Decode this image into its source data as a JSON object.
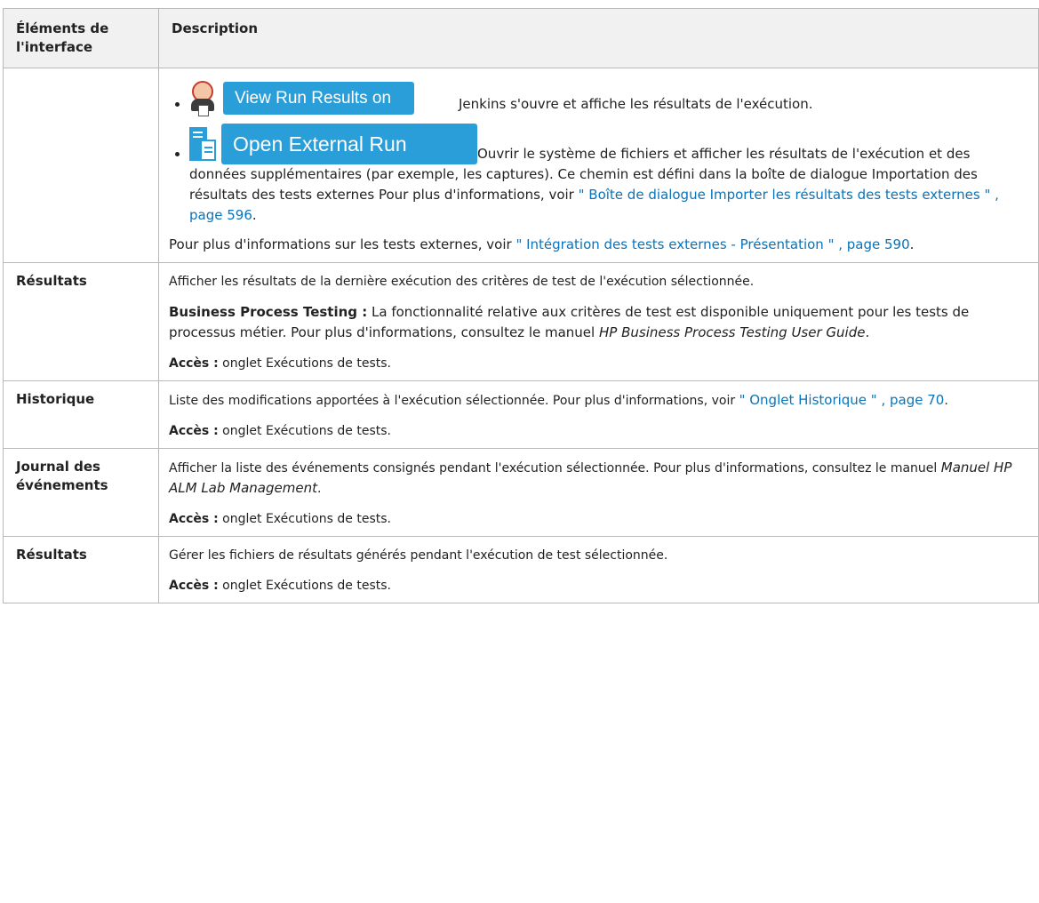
{
  "header": {
    "col1": "Éléments de l'interface",
    "col2": "Description"
  },
  "row_buttons": {
    "jenkins": {
      "button_label": "View Run Results on Jenkins",
      "icon": "jenkins-icon",
      "text": "Jenkins s'ouvre et affiche les résultats de l'exécution."
    },
    "external": {
      "button_label": "Open External Run Results Path",
      "icon": "file-document-icon",
      "text": "Ouvrir le système de fichiers et afficher les résultats de l'exécution et des données supplémentaires (par exemple, les captures). Ce chemin est défini dans la boîte de dialogue Importation des résultats des tests externes Pour plus d'informations, voir ",
      "link": "\" Boîte de dialogue Importer les résultats des tests externes \" , page 596",
      "after": "."
    },
    "footer_text": "Pour plus d'informations sur les tests externes, voir ",
    "footer_link": "\" Intégration des tests externes - Présentation \" , page 590",
    "footer_after": "."
  },
  "rows": [
    {
      "name": "Résultats",
      "desc": "Afficher les résultats de la dernière exécution des critères de test de l'exécution sélectionnée.",
      "bpt_label": "Business Process Testing :",
      "bpt_text": " La fonctionnalité relative aux critères de test est disponible uniquement pour les tests de processus métier. Pour plus d'informations, consultez le manuel ",
      "bpt_ital": "HP Business Process Testing User Guide",
      "bpt_after": ".",
      "access_label": "Accès :",
      "access_text": " onglet Exécutions de tests."
    },
    {
      "name": "Historique",
      "desc": "Liste des modifications apportées à l'exécution sélectionnée. Pour plus d'informations, voir ",
      "link": "\" Onglet Historique \" , page 70",
      "after": ".",
      "access_label": "Accès :",
      "access_text": " onglet Exécutions de tests."
    },
    {
      "name": "Journal des événements",
      "desc": "Afficher la liste des événements consignés pendant l'exécution sélectionnée. Pour plus d'informations, consultez le manuel ",
      "ital": "Manuel HP ALM Lab Management",
      "after": ".",
      "access_label": "Accès :",
      "access_text": " onglet Exécutions de tests."
    },
    {
      "name": "Résultats",
      "desc": "Gérer les fichiers de résultats générés pendant l'exécution de test sélectionnée.",
      "access_label": "Accès :",
      "access_text": " onglet Exécutions de tests."
    }
  ],
  "colors": {
    "link": "#0a73b9",
    "button": "#2a9ed8",
    "header_bg": "#f1f1f1",
    "border": "#b8b8b8"
  }
}
